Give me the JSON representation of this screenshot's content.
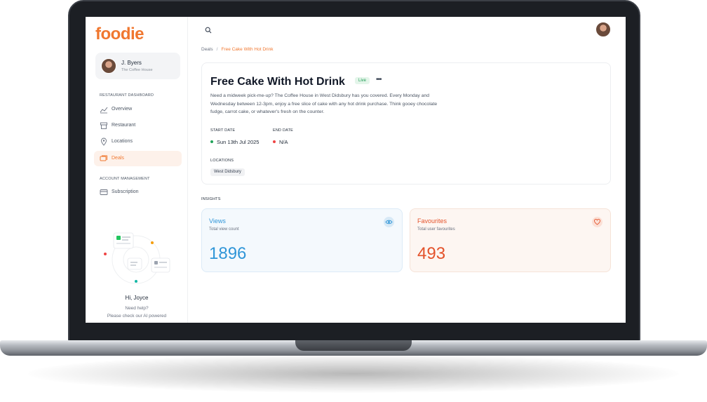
{
  "app": {
    "logo": "foodie"
  },
  "profile": {
    "name": "J. Byers",
    "venue": "The Coffee House"
  },
  "sidebar": {
    "section1": "RESTAURANT DASHBOARD",
    "items": [
      {
        "label": "Overview",
        "icon": "chart-icon"
      },
      {
        "label": "Restaurant",
        "icon": "store-icon"
      },
      {
        "label": "Locations",
        "icon": "pin-icon"
      },
      {
        "label": "Deals",
        "icon": "ticket-icon"
      }
    ],
    "section2": "ACCOUNT MANAGEMENT",
    "items2": [
      {
        "label": "Subscription",
        "icon": "card-icon"
      }
    ],
    "greeting": "Hi, Joyce",
    "help_line1": "Need help?",
    "help_line2": "Please check our AI powered"
  },
  "breadcrumb": {
    "root": "Deals",
    "sep": "/",
    "current": "Free Cake With Hot Drink"
  },
  "deal": {
    "title": "Free Cake With Hot Drink",
    "status": "Live",
    "more": "•••",
    "description": "Need a midweek pick-me-up? The Coffee House in West Didsbury has you covered. Every Monday and Wednesday between 12-3pm, enjoy a free slice of cake with any hot drink purchase. Think gooey chocolate fudge, carrot cake, or whatever's fresh on the counter.",
    "start_label": "START DATE",
    "start_value": "Sun 13th Jul 2025",
    "end_label": "END DATE",
    "end_value": "N/A",
    "locations_label": "LOCATIONS",
    "locations": [
      "West Didsbury"
    ]
  },
  "insights": {
    "label": "INSIGHTS",
    "views": {
      "title": "Views",
      "subtitle": "Total view count",
      "value": "1896"
    },
    "favourites": {
      "title": "Favourites",
      "subtitle": "Total user favourites",
      "value": "493"
    }
  },
  "colors": {
    "brand": "#f0772f",
    "views": "#3096d8",
    "favourites": "#e4532c",
    "live": "#1f9d55"
  }
}
